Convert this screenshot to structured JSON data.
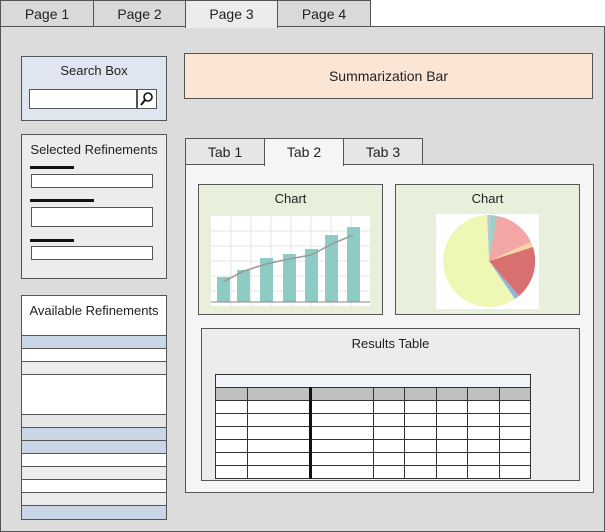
{
  "page_tabs": [
    {
      "label": "Page 1",
      "active": false
    },
    {
      "label": "Page 2",
      "active": false
    },
    {
      "label": "Page 3",
      "active": true
    },
    {
      "label": "Page 4",
      "active": false
    }
  ],
  "search_box": {
    "title": "Search Box",
    "value": "",
    "button_icon": "magnifier-icon"
  },
  "selected_refinements": {
    "title": "Selected Refinements"
  },
  "available_refinements": {
    "title": "Available Refinements"
  },
  "summarization_bar": {
    "label": "Summarization Bar"
  },
  "inner_tabs": [
    {
      "label": "Tab 1",
      "active": false
    },
    {
      "label": "Tab 2",
      "active": true
    },
    {
      "label": "Tab 3",
      "active": false
    }
  ],
  "charts": [
    {
      "title": "Chart"
    },
    {
      "title": "Chart"
    }
  ],
  "results_table": {
    "title": "Results Table"
  },
  "colors": {
    "search_panel": "#dfe6f0",
    "summary_bar": "#fbe6d6",
    "chart_card": "#e8f0dc",
    "bar_fill": "#8fcbc5",
    "pie_main": "#eef7b3",
    "pie_red": "#d97070",
    "pie_pink": "#f2a6a6",
    "refinement_highlight": "#c9d6e6"
  }
}
